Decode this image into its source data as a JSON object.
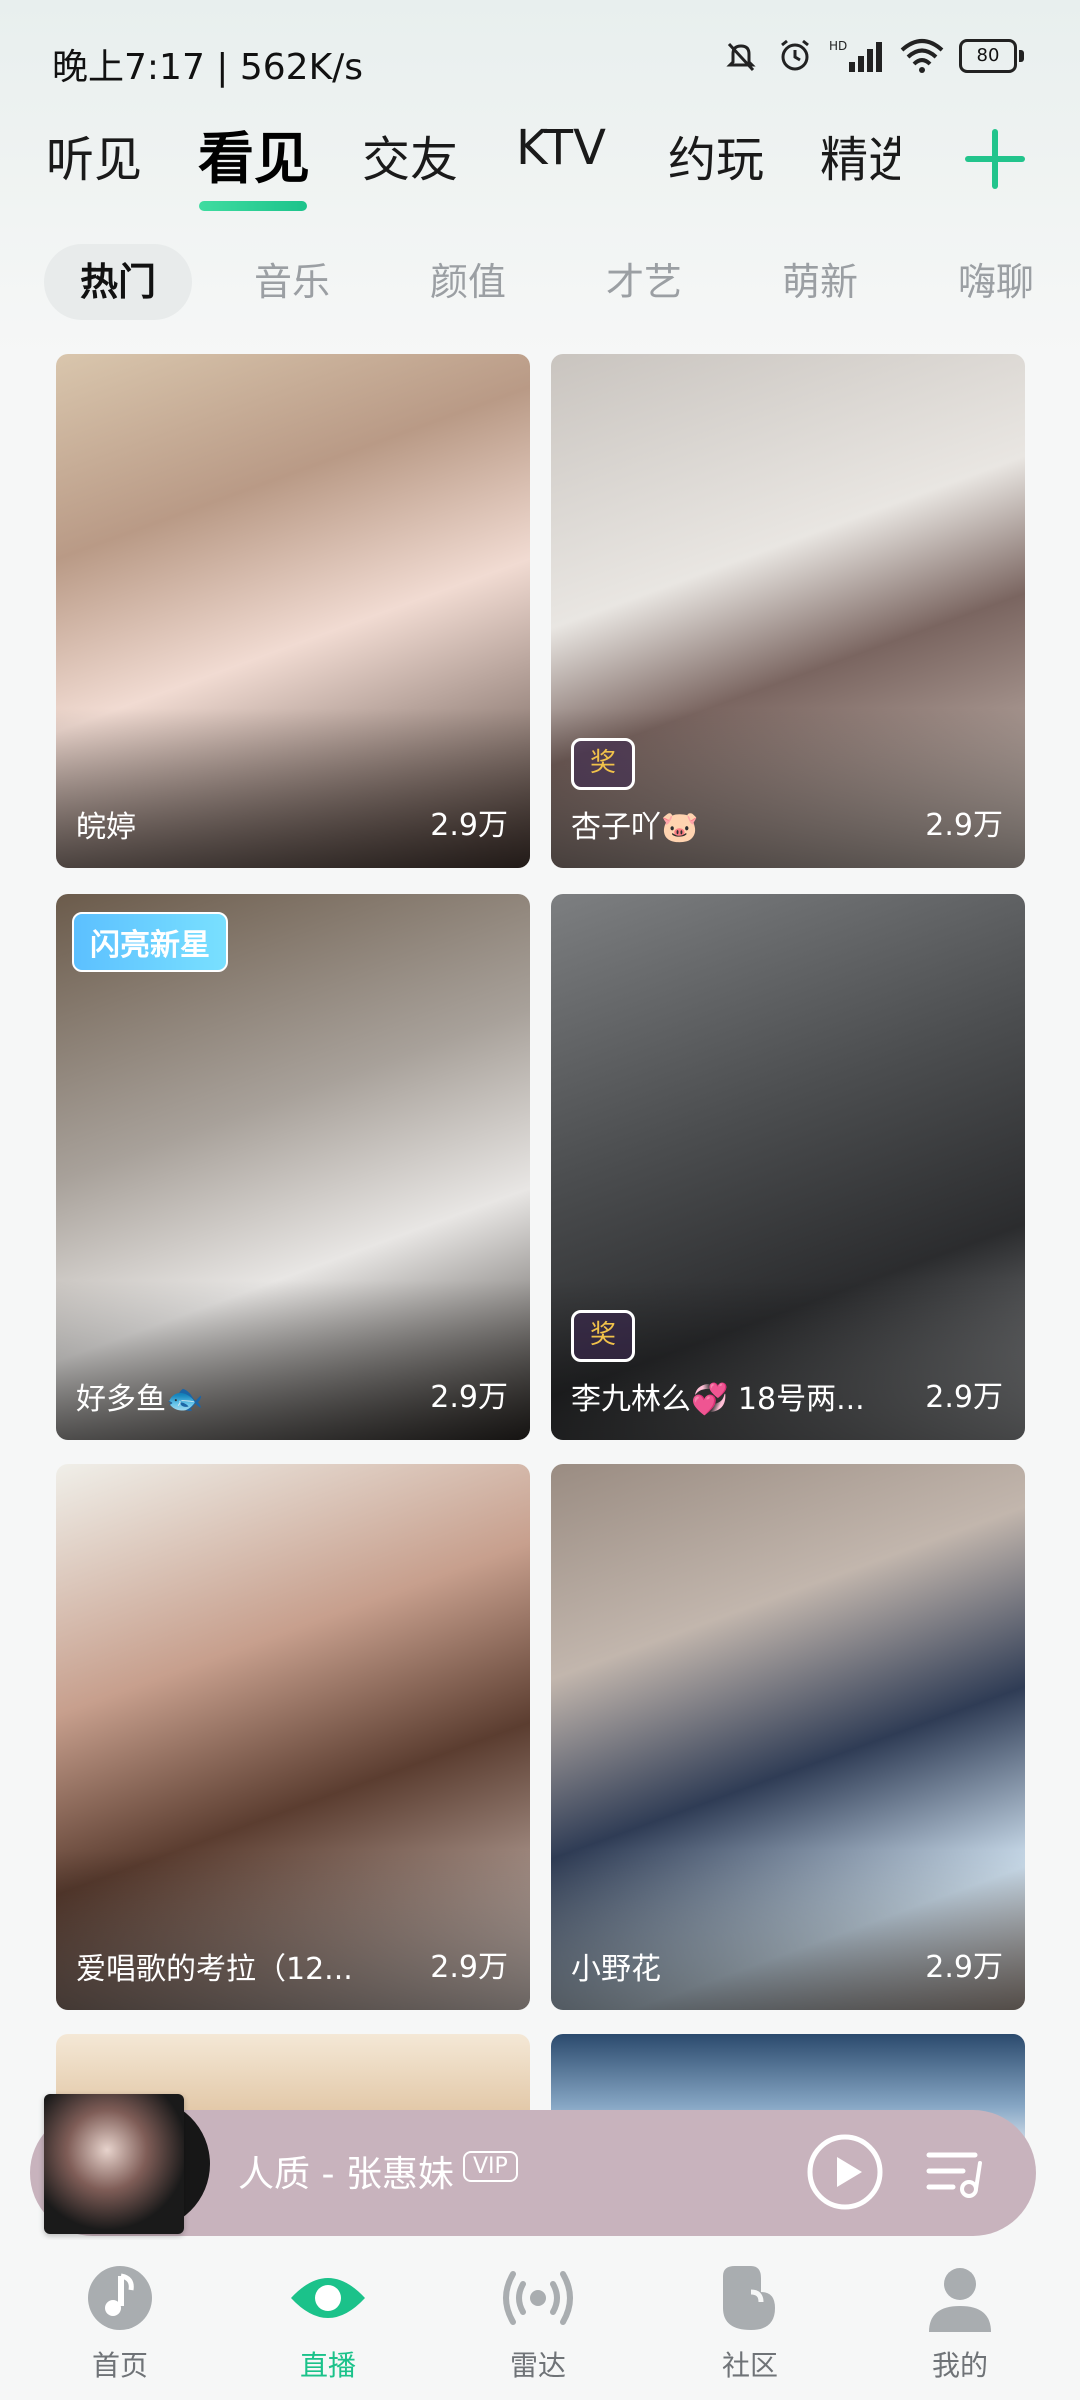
{
  "status_bar": {
    "time": "晚上7:17 | 562K/s",
    "battery": "80",
    "icons": [
      "mute-bell-icon",
      "alarm-icon",
      "hd-signal-icon",
      "wifi-icon",
      "battery-icon"
    ]
  },
  "main_tabs": [
    {
      "label": "听见"
    },
    {
      "label": "看见",
      "active": true
    },
    {
      "label": "交友"
    },
    {
      "label": "KTV"
    },
    {
      "label": "约玩"
    },
    {
      "label": "精选"
    }
  ],
  "sub_tabs": [
    {
      "label": "热门",
      "active": true
    },
    {
      "label": "音乐"
    },
    {
      "label": "颜值"
    },
    {
      "label": "才艺"
    },
    {
      "label": "萌新"
    },
    {
      "label": "嗨聊"
    }
  ],
  "cards": [
    {
      "name": "皖婷",
      "count": "2.9万"
    },
    {
      "name": "杏子吖🐷",
      "count": "2.9万",
      "badge": "奖"
    },
    {
      "name": "好多鱼🐟",
      "count": "2.9万",
      "tag": "闪亮新星"
    },
    {
      "name": "李九林么💞 18号两...",
      "count": "2.9万",
      "badge": "奖"
    },
    {
      "name": "爱唱歌的考拉（12...",
      "count": "2.9万"
    },
    {
      "name": "小野花",
      "count": "2.9万"
    }
  ],
  "player": {
    "song": "人质 - 张惠妹",
    "vip": "VIP"
  },
  "bottom_nav": [
    {
      "label": "首页",
      "icon": "music-note-icon"
    },
    {
      "label": "直播",
      "icon": "eye-icon",
      "active": true
    },
    {
      "label": "雷达",
      "icon": "radar-icon"
    },
    {
      "label": "社区",
      "icon": "community-icon"
    },
    {
      "label": "我的",
      "icon": "profile-icon"
    }
  ],
  "colors": {
    "accent": "#1bc28a",
    "player_bg": "#c8b3bd"
  }
}
